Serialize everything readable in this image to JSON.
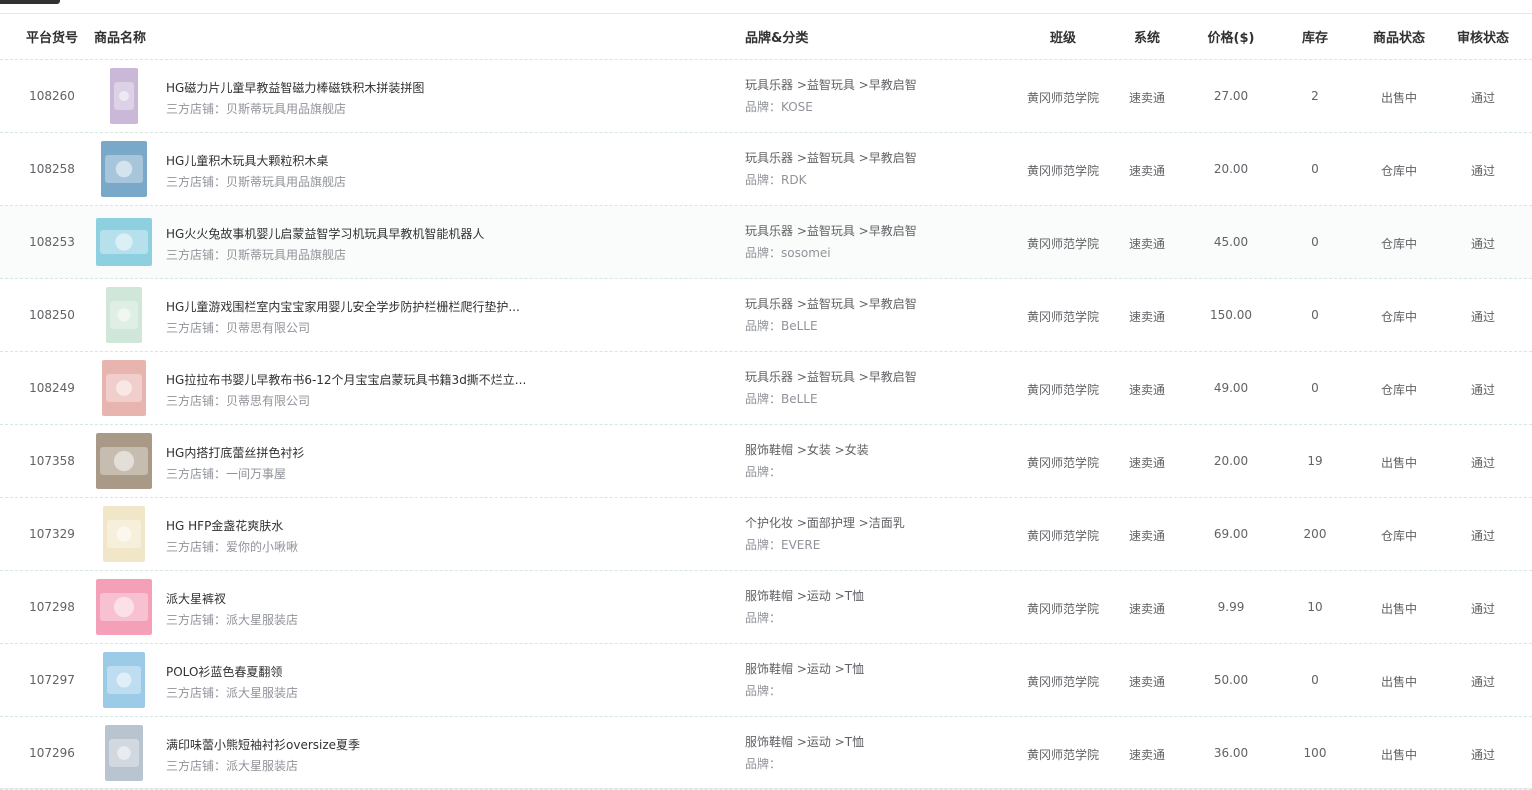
{
  "columns": {
    "id": "平台货号",
    "name": "商品名称",
    "brand_cat": "品牌&分类",
    "class": "班级",
    "system": "系统",
    "price": "价格($)",
    "stock": "库存",
    "status": "商品状态",
    "audit": "审核状态"
  },
  "rows": [
    {
      "id": "108260",
      "name": "HG磁力片儿童早教益智磁力棒磁铁积木拼装拼图",
      "shop": "三方店铺：贝斯蒂玩具用品旗舰店",
      "category": "玩具乐器 >益智玩具 >早教启智",
      "brand": "品牌：KOSE",
      "class": "黄冈师范学院",
      "system": "速卖通",
      "price": "27.00",
      "stock": "2",
      "status": "出售中",
      "audit": "通过",
      "thumb_color": "#c9b8d8",
      "thumb_icon": "magnetic-tiles-image"
    },
    {
      "id": "108258",
      "name": "HG儿童积木玩具大颗粒积木桌",
      "shop": "三方店铺：贝斯蒂玩具用品旗舰店",
      "category": "玩具乐器 >益智玩具 >早教启智",
      "brand": "品牌：RDK",
      "class": "黄冈师范学院",
      "system": "速卖通",
      "price": "20.00",
      "stock": "0",
      "status": "仓库中",
      "audit": "通过",
      "thumb_color": "#7aa8c8",
      "thumb_icon": "block-table-image"
    },
    {
      "id": "108253",
      "name": "HG火火兔故事机婴儿启蒙益智学习机玩具早教机智能机器人",
      "shop": "三方店铺：贝斯蒂玩具用品旗舰店",
      "category": "玩具乐器 >益智玩具 >早教启智",
      "brand": "品牌：sosomei",
      "class": "黄冈师范学院",
      "system": "速卖通",
      "price": "45.00",
      "stock": "0",
      "status": "仓库中",
      "audit": "通过",
      "thumb_color": "#8fd0e0",
      "thumb_icon": "rabbit-robot-image"
    },
    {
      "id": "108250",
      "name": "HG儿童游戏围栏室内宝宝家用婴儿安全学步防护栏栅栏爬行垫护...",
      "shop": "三方店铺：贝蒂思有限公司",
      "category": "玩具乐器 >益智玩具 >早教启智",
      "brand": "品牌：BeLLE",
      "class": "黄冈师范学院",
      "system": "速卖通",
      "price": "150.00",
      "stock": "0",
      "status": "仓库中",
      "audit": "通过",
      "thumb_color": "#cfe6d8",
      "thumb_icon": "playpen-image"
    },
    {
      "id": "108249",
      "name": "HG拉拉布书婴儿早教布书6-12个月宝宝启蒙玩具书籍3d撕不烂立...",
      "shop": "三方店铺：贝蒂思有限公司",
      "category": "玩具乐器 >益智玩具 >早教启智",
      "brand": "品牌：BeLLE",
      "class": "黄冈师范学院",
      "system": "速卖通",
      "price": "49.00",
      "stock": "0",
      "status": "仓库中",
      "audit": "通过",
      "thumb_color": "#e8b4b0",
      "thumb_icon": "cloth-book-image"
    },
    {
      "id": "107358",
      "name": "HG内搭打底蕾丝拼色衬衫",
      "shop": "三方店铺：一间万事屋",
      "category": "服饰鞋帽 >女装 >女装",
      "brand": "品牌：",
      "class": "黄冈师范学院",
      "system": "速卖通",
      "price": "20.00",
      "stock": "19",
      "status": "出售中",
      "audit": "通过",
      "thumb_color": "#a89a86",
      "thumb_icon": "lace-shirt-image"
    },
    {
      "id": "107329",
      "name": "HG HFP金盏花爽肤水",
      "shop": "三方店铺：爱你的小啾啾",
      "category": "个护化妆 >面部护理 >洁面乳",
      "brand": "品牌：EVERE",
      "class": "黄冈师范学院",
      "system": "速卖通",
      "price": "69.00",
      "stock": "200",
      "status": "仓库中",
      "audit": "通过",
      "thumb_color": "#f2e6c8",
      "thumb_icon": "toner-bottle-image"
    },
    {
      "id": "107298",
      "name": "派大星裤衩",
      "shop": "三方店铺：派大星服装店",
      "category": "服饰鞋帽 >运动 >T恤",
      "brand": "品牌：",
      "class": "黄冈师范学院",
      "system": "速卖通",
      "price": "9.99",
      "stock": "10",
      "status": "出售中",
      "audit": "通过",
      "thumb_color": "#f4a0b8",
      "thumb_icon": "patrick-star-image"
    },
    {
      "id": "107297",
      "name": "POLO衫蓝色春夏翻领",
      "shop": "三方店铺：派大星服装店",
      "category": "服饰鞋帽 >运动 >T恤",
      "brand": "品牌：",
      "class": "黄冈师范学院",
      "system": "速卖通",
      "price": "50.00",
      "stock": "0",
      "status": "出售中",
      "audit": "通过",
      "thumb_color": "#9ccbe8",
      "thumb_icon": "polo-shirt-image"
    },
    {
      "id": "107296",
      "name": "满印味蕾小熊短袖衬衫oversize夏季",
      "shop": "三方店铺：派大星服装店",
      "category": "服饰鞋帽 >运动 >T恤",
      "brand": "品牌：",
      "class": "黄冈师范学院",
      "system": "速卖通",
      "price": "36.00",
      "stock": "100",
      "status": "出售中",
      "audit": "通过",
      "thumb_color": "#b8c4d0",
      "thumb_icon": "bear-shirt-image"
    }
  ]
}
